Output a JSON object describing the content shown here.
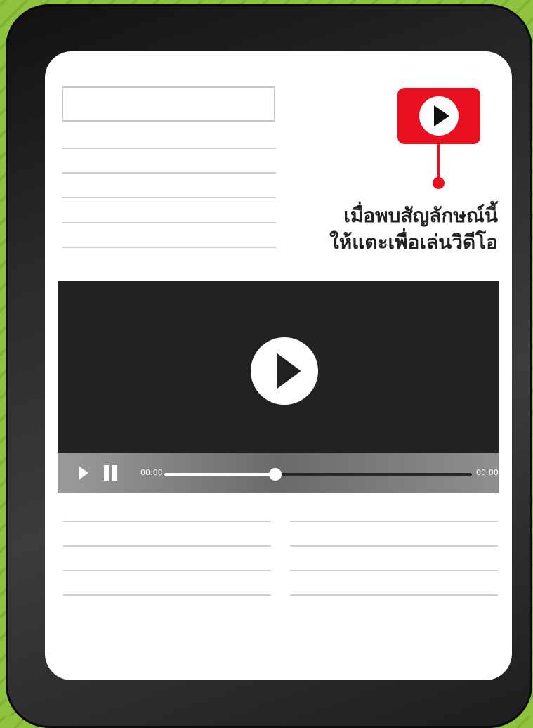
{
  "background_color": "#8ec23f",
  "accent_color": "#e8101e",
  "article": {
    "title_placeholder": "",
    "hint_line1": "เมื่อพบสัญลักษณ์นี้",
    "hint_line2": "ให้แตะเพื่อเล่นวิดีโอ",
    "badge_icon": "play-circle-icon"
  },
  "video": {
    "big_play_icon": "play-circle-icon",
    "player": {
      "play_icon": "play-icon",
      "pause_icon": "pause-icon",
      "time_start": "00:00",
      "time_end": "00:00",
      "progress": 0.36
    }
  }
}
